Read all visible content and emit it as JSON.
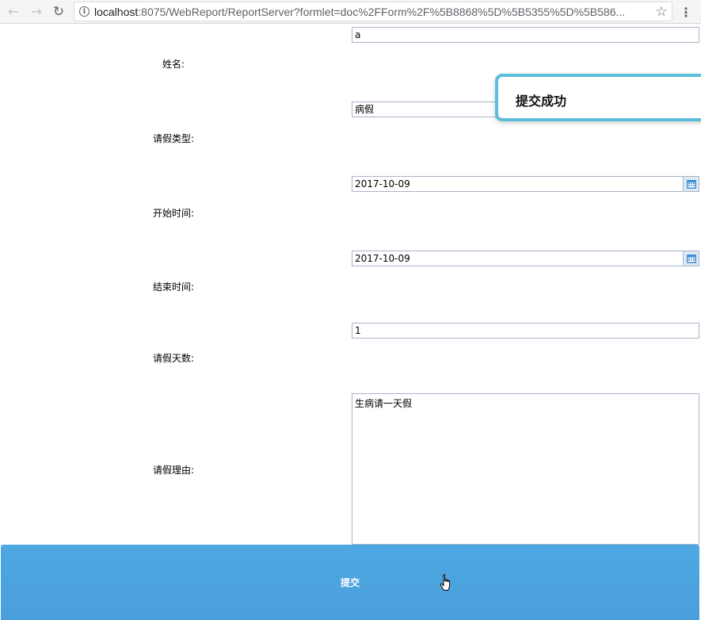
{
  "browser": {
    "url_host": "localhost",
    "url_rest": ":8075/WebReport/ReportServer?formlet=doc%2FForm%2F%5B8868%5D%5B5355%5D%5B586..."
  },
  "form": {
    "name": {
      "label": "姓名:",
      "value": "a"
    },
    "leave_type": {
      "label": "请假类型:",
      "value": "病假"
    },
    "start_time": {
      "label": "开始时间:",
      "value": "2017-10-09"
    },
    "end_time": {
      "label": "结束时间:",
      "value": "2017-10-09"
    },
    "days": {
      "label": "请假天数:",
      "value": "1"
    },
    "reason": {
      "label": "请假理由:",
      "value": "生病请一天假"
    }
  },
  "toast": {
    "message": "提交成功",
    "border_color": "#5bbfdc"
  },
  "submit": {
    "label": "提交",
    "color": "#4ea8e2"
  },
  "icons": {
    "back": "back-arrow-icon",
    "forward": "forward-arrow-icon",
    "reload": "reload-icon",
    "info": "info-icon",
    "star": "star-icon",
    "menu": "menu-dots-icon",
    "calendar": "calendar-icon",
    "cursor": "hand-pointer-icon"
  }
}
